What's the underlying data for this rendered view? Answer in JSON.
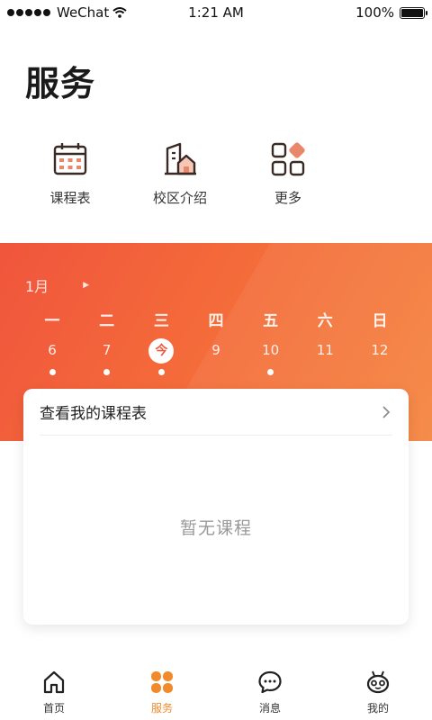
{
  "status_bar": {
    "carrier": "WeChat",
    "time": "1:21 AM",
    "battery": "100%"
  },
  "page_title": "服务",
  "quick_menu": [
    {
      "label": "课程表",
      "icon": "calendar-icon"
    },
    {
      "label": "校区介绍",
      "icon": "campus-building-icon"
    },
    {
      "label": "更多",
      "icon": "more-grid-icon"
    }
  ],
  "calendar": {
    "month": "1月",
    "weekdays": [
      "一",
      "二",
      "三",
      "四",
      "五",
      "六",
      "日"
    ],
    "dates": [
      "6",
      "7",
      "今",
      "9",
      "10",
      "11",
      "12"
    ],
    "today_index": 2,
    "has_course_dots": [
      true,
      true,
      true,
      false,
      true,
      false,
      false
    ]
  },
  "schedule_card": {
    "title": "查看我的课程表",
    "empty_text": "暂无课程"
  },
  "tab_bar": [
    {
      "label": "首页",
      "icon": "home-icon",
      "active": false
    },
    {
      "label": "服务",
      "icon": "service-clover-icon",
      "active": true
    },
    {
      "label": "消息",
      "icon": "message-icon",
      "active": false
    },
    {
      "label": "我的",
      "icon": "profile-robot-icon",
      "active": false
    }
  ],
  "colors": {
    "accent": "#f05a3c",
    "tab_active": "#f08a2c",
    "band_end": "#f5853f"
  }
}
